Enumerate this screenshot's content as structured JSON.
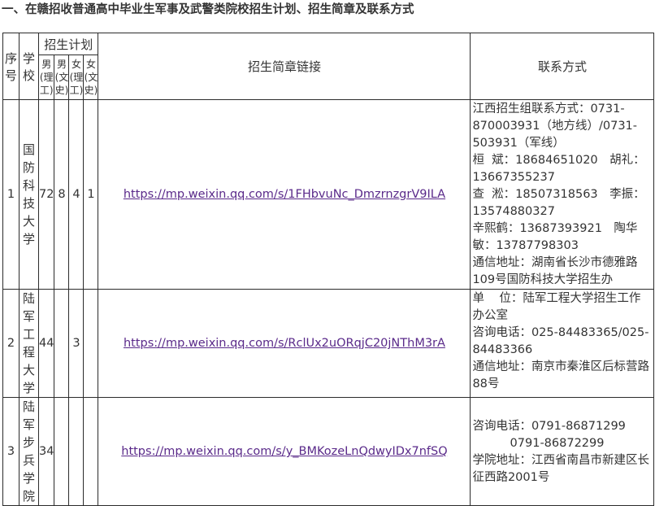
{
  "page": {
    "heading": "一、在赣招收普通高中毕业生军事及武警类院校招生计划、招生简章及联系方式"
  },
  "table": {
    "headers": {
      "index": "序号",
      "school": "学校",
      "plan": "招生计划",
      "male_sci": "男(理工)",
      "male_arts": "男(文史)",
      "female_sci": "女(理工)",
      "female_arts": "女(文史)",
      "link": "招生简章链接",
      "contact": "联系方式"
    },
    "rows": [
      {
        "index": "1",
        "school": "国防科技大学",
        "male_sci": "72",
        "male_arts": "8",
        "female_sci": "4",
        "female_arts": "1",
        "link": "https://mp.weixin.qq.com/s/1FHbvuNc_DmzrnzgrV9ILA",
        "contact": [
          "江西招生组联系方式：0731-870003931（地方线）/0731-503931（军线）",
          "桓  斌：18684651020　胡礼：13667355237",
          "查  淞：18507318563　李振：13574880327",
          "辛熙鹤：13687393921　陶华敏：13787798303",
          "通信地址：湖南省长沙市德雅路109号国防科技大学招生办"
        ]
      },
      {
        "index": "2",
        "school": "陆军工程大学",
        "male_sci": "44",
        "male_arts": "",
        "female_sci": "3",
        "female_arts": "",
        "link": "https://mp.weixin.qq.com/s/RclUx2uORqjC20jNThM3rA",
        "contact": [
          "单    位：陆军工程大学招生工作办公室",
          "咨询电话：025-84483365/025-84483366",
          "通信地址：南京市秦淮区后标营路88号"
        ]
      },
      {
        "index": "3",
        "school": "陆军步兵学院",
        "male_sci": "34",
        "male_arts": "",
        "female_sci": "",
        "female_arts": "",
        "link": "https://mp.weixin.qq.com/s/y_BMKozeLnQdwyIDx7nfSQ",
        "contact": [
          "咨询电话：0791-86871299",
          "          0791-86872299",
          "学院地址：江西省南昌市新建区长征西路2001号"
        ]
      }
    ]
  }
}
